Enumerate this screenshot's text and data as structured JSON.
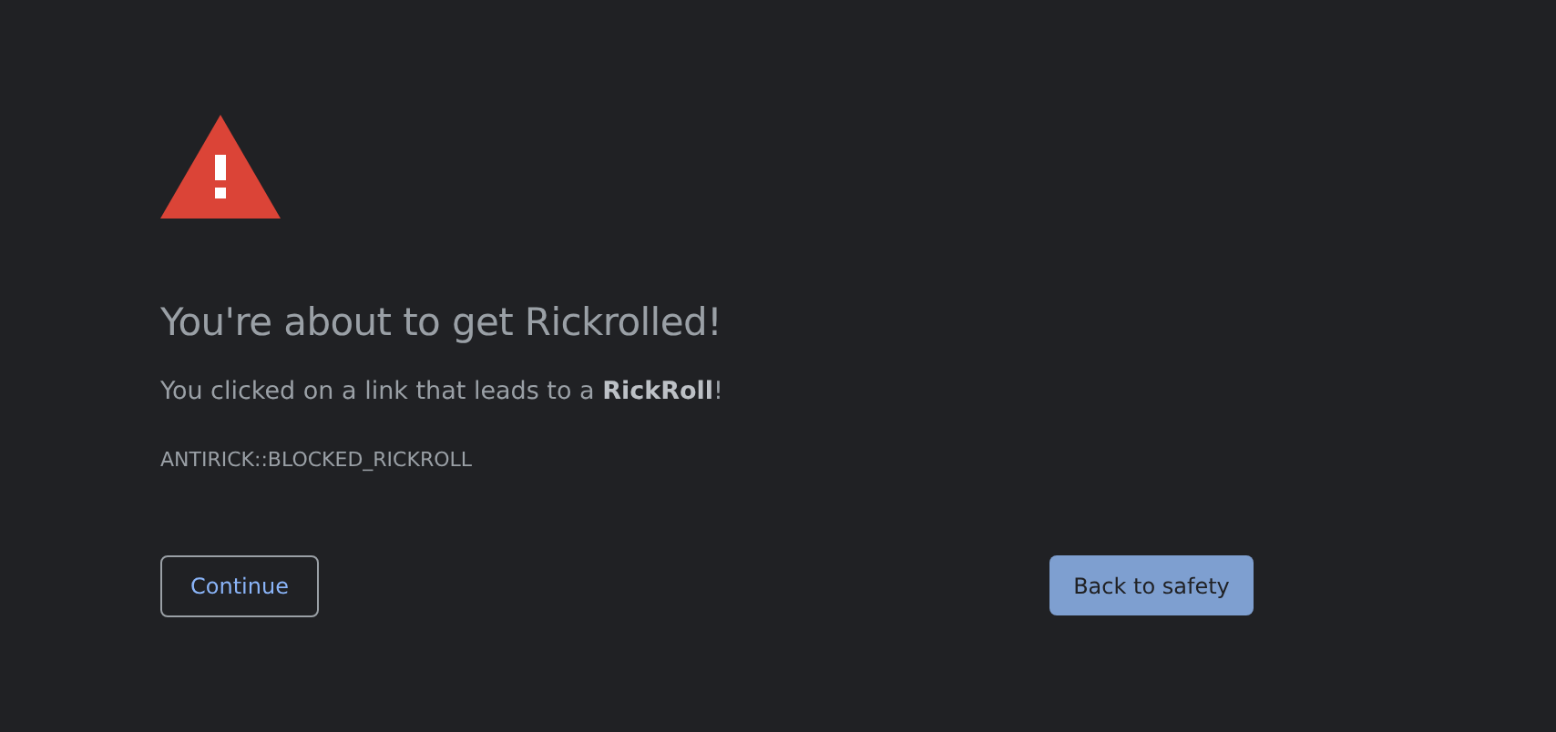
{
  "heading": "You're about to get Rickrolled!",
  "message": "You clicked on a link that leads to a **RickRoll**!",
  "error_code": "ANTIRICK::BLOCKED_RICKROLL",
  "buttons": [
    {
      "label": "Continue",
      "kind": "secondary"
    },
    {
      "label": "Back to safety",
      "kind": "primary"
    }
  ]
}
